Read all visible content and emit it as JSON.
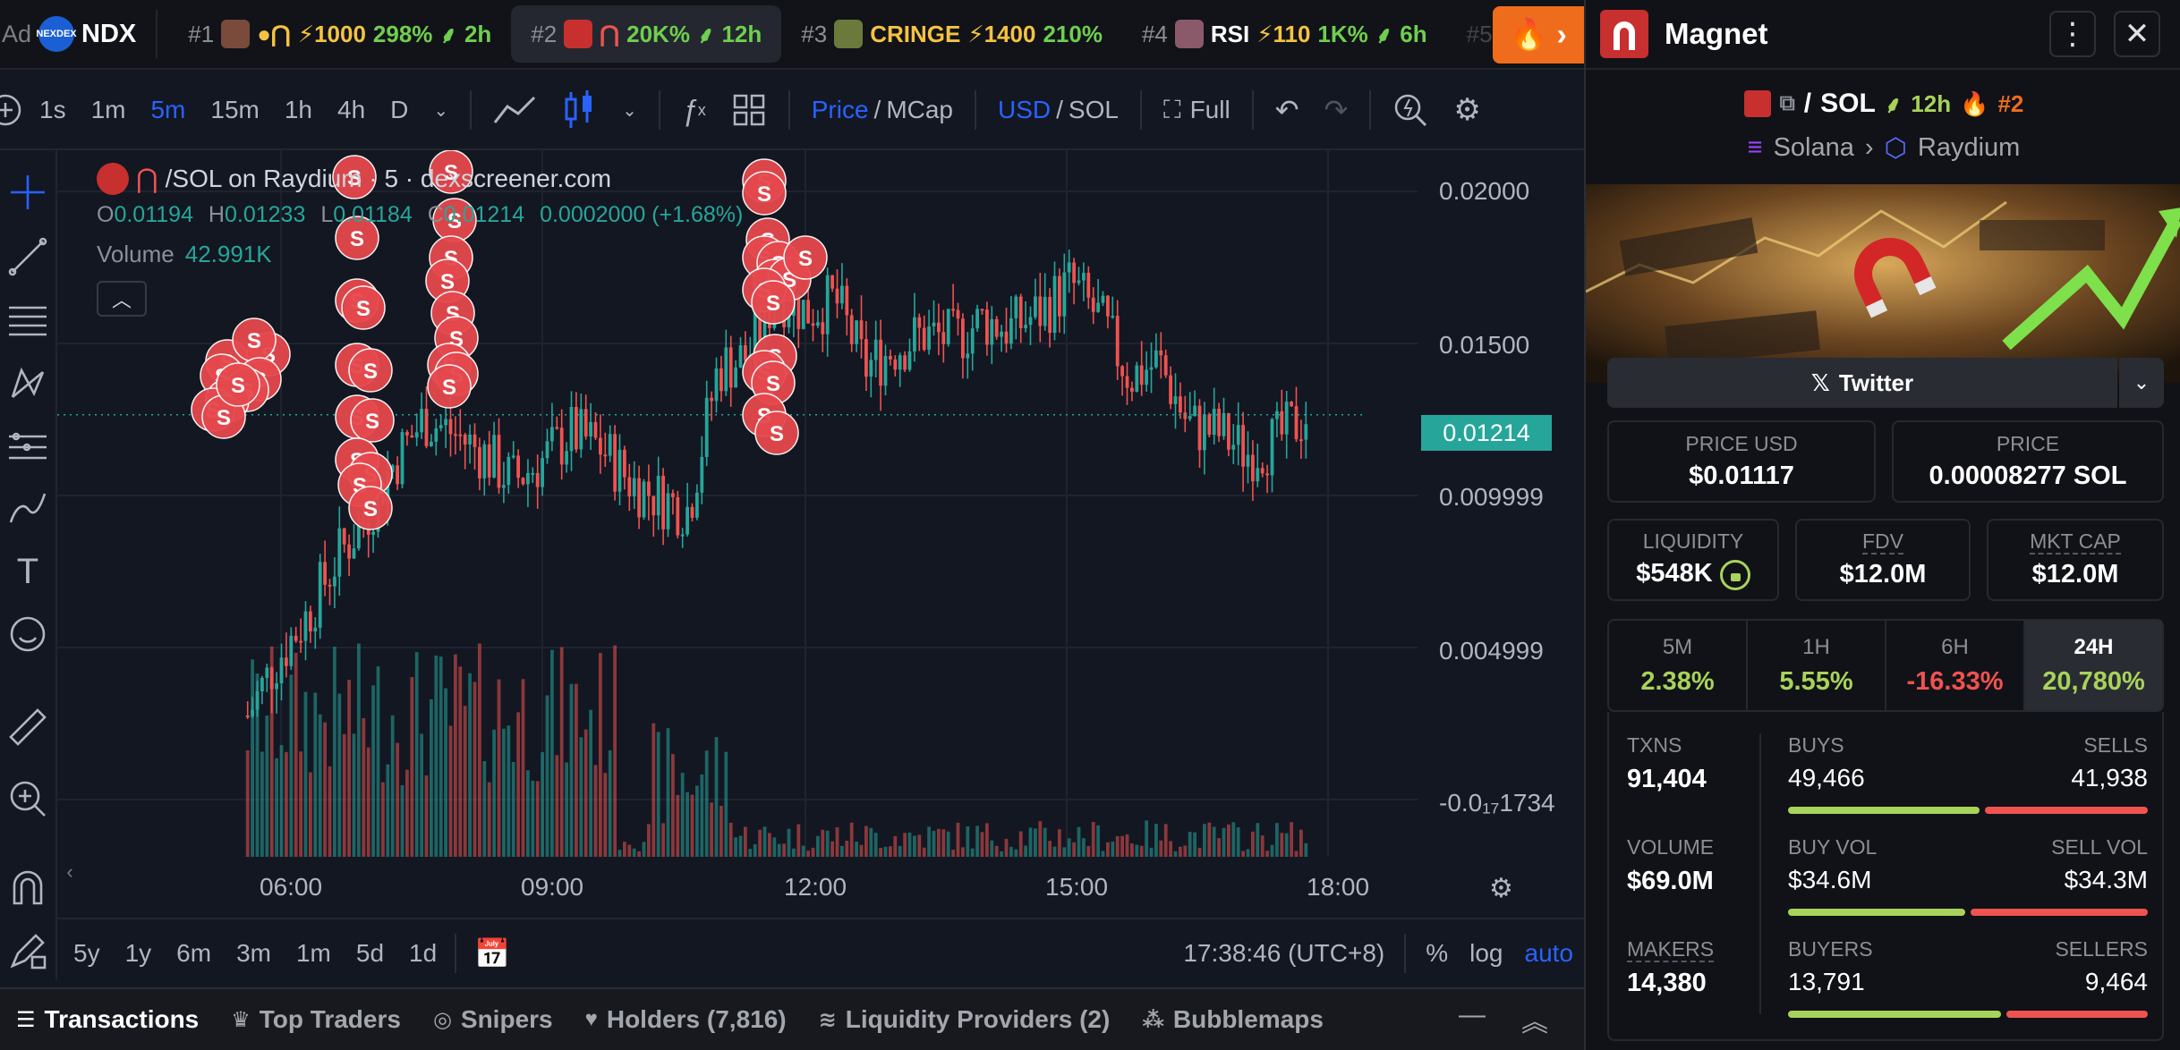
{
  "ticker": {
    "ad_label": "Ad",
    "ad_logo_text": "NEXDEX",
    "ad_name": "NDX",
    "items": [
      {
        "rank": "#1",
        "name": "",
        "boost": "⚡1000",
        "change": "298%",
        "age": "2h"
      },
      {
        "rank": "#2",
        "name": "",
        "boost": "",
        "change": "20K%",
        "age": "12h"
      },
      {
        "rank": "#3",
        "name": "CRINGE",
        "boost": "⚡1400",
        "change": "210%",
        "age": ""
      },
      {
        "rank": "#4",
        "name": "RSI",
        "boost": "⚡110",
        "change": "1K%",
        "age": "6h"
      },
      {
        "rank": "#5",
        "name": "",
        "boost": "",
        "change": "",
        "age": ""
      }
    ]
  },
  "toolbar": {
    "intervals": [
      "1s",
      "1m",
      "5m",
      "15m",
      "1h",
      "4h",
      "D"
    ],
    "active_interval": "5m",
    "price_label": "Price",
    "mcap_label": "MCap",
    "usd_label": "USD",
    "sol_label": "SOL",
    "full_label": "Full",
    "slash": "/"
  },
  "chart_legend": {
    "title": "/SOL on Raydium · 5 · dexscreener.com",
    "o_label": "O",
    "o": "0.01194",
    "h_label": "H",
    "h": "0.01233",
    "l_label": "L",
    "l": "0.01184",
    "c_label": "C",
    "c": "0.01214",
    "change": "0.0002000 (+1.68%)",
    "volume_label": "Volume",
    "volume": "42.991K"
  },
  "chart_data": {
    "type": "candlestick",
    "y_ticks": [
      "0.02000",
      "0.01500",
      "0.009999",
      "0.004999",
      "-0.0₁₇1734"
    ],
    "x_ticks": [
      "06:00",
      "09:00",
      "12:00",
      "15:00",
      "18:00"
    ],
    "last_price": "0.01214",
    "marker_label": "S",
    "ylim": [
      -0.0035,
      0.0215
    ],
    "x": [
      "05:40",
      "06:00",
      "06:20",
      "06:40",
      "07:00",
      "07:20",
      "07:40",
      "08:00",
      "08:20",
      "08:40",
      "09:00",
      "09:20",
      "09:40",
      "10:00",
      "10:20",
      "10:40",
      "11:00",
      "11:20",
      "11:40",
      "12:00",
      "12:20",
      "12:40",
      "13:00",
      "13:20",
      "13:40",
      "14:00",
      "14:20",
      "14:40",
      "15:00",
      "15:20",
      "15:40",
      "16:00",
      "16:20",
      "16:40",
      "17:00",
      "17:20",
      "17:38"
    ],
    "close": [
      0.0015,
      0.0035,
      0.005,
      0.007,
      0.0085,
      0.0105,
      0.012,
      0.0115,
      0.0108,
      0.0098,
      0.0105,
      0.0115,
      0.011,
      0.0098,
      0.0092,
      0.0088,
      0.0138,
      0.0142,
      0.0165,
      0.0158,
      0.0162,
      0.0138,
      0.0145,
      0.015,
      0.0148,
      0.0155,
      0.0152,
      0.0158,
      0.0168,
      0.0155,
      0.0135,
      0.014,
      0.0118,
      0.0115,
      0.0108,
      0.0112,
      0.01214
    ]
  },
  "chart_bottom": {
    "ranges": [
      "5y",
      "1y",
      "6m",
      "3m",
      "1m",
      "5d",
      "1d"
    ],
    "time": "17:38:46 (UTC+8)",
    "percent": "%",
    "log": "log",
    "auto": "auto"
  },
  "bottom_tabs": [
    "Transactions",
    "Top Traders",
    "Snipers",
    "Holders (7,816)",
    "Liquidity Providers (2)",
    "Bubblemaps"
  ],
  "panel": {
    "title": "Magnet",
    "pair_quote": "SOL",
    "pair_age": "12h",
    "pair_rank": "#2",
    "chain": "Solana",
    "dex": "Raydium",
    "twitter": "Twitter",
    "price_usd_label": "PRICE USD",
    "price_usd": "$0.01117",
    "price_sol_label": "PRICE",
    "price_sol": "0.00008277 SOL",
    "liquidity_label": "LIQUIDITY",
    "liquidity": "$548K",
    "fdv_label": "FDV",
    "fdv": "$12.0M",
    "mcap_label": "MKT CAP",
    "mcap": "$12.0M",
    "periods": [
      {
        "label": "5M",
        "value": "2.38%"
      },
      {
        "label": "1H",
        "value": "5.55%"
      },
      {
        "label": "6H",
        "value": "-16.33%"
      },
      {
        "label": "24H",
        "value": "20,780%"
      }
    ],
    "txns_label": "TXNS",
    "txns": "91,404",
    "buys_label": "BUYS",
    "buys": "49,466",
    "sells_label": "SELLS",
    "sells": "41,938",
    "volume_label": "VOLUME",
    "volume": "$69.0M",
    "buy_vol_label": "BUY VOL",
    "buy_vol": "$34.6M",
    "sell_vol_label": "SELL VOL",
    "sell_vol": "$34.3M",
    "makers_label": "MAKERS",
    "makers": "14,380",
    "buyers_label": "BUYERS",
    "buyers": "13,791",
    "sellers_label": "SELLERS",
    "sellers": "9,464",
    "buy_share": 0.54,
    "buy_vol_share": 0.5,
    "buyer_share": 0.6
  },
  "colors": {
    "up": "#26a69a",
    "down": "#ef5350",
    "accent": "#2962ff",
    "green_text": "#a8d35a"
  }
}
